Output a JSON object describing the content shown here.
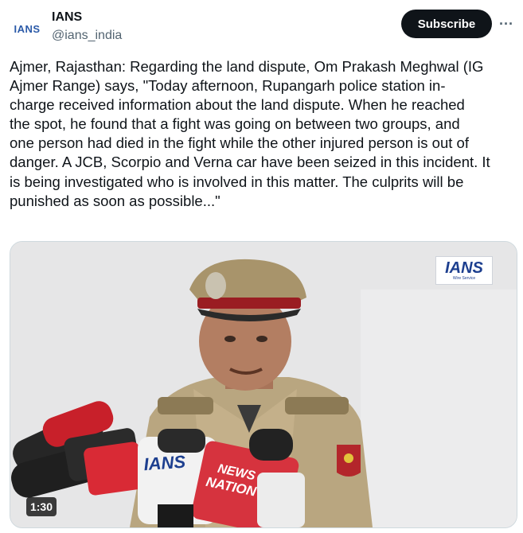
{
  "account": {
    "avatar_text": "IANS",
    "name": "IANS",
    "handle": "@ians_india"
  },
  "actions": {
    "subscribe_label": "Subscribe",
    "more_icon": "more-horizontal-icon",
    "more_glyph": "···"
  },
  "tweet": {
    "text": "Ajmer, Rajasthan: Regarding the land dispute, Om Prakash Meghwal (IG\nAjmer Range) says, \"Today afternoon, Rupangarh police station in-\ncharge received information about the land dispute. When he reached\nthe spot, he found that a fight was going on between two groups, and\none person had died in the fight while the other injured person is out of\ndanger. A JCB, Scorpio and Verna car have been seized in this incident. It\nis being investigated who is involved in this matter. The culprits will be\npunished as soon as possible...\""
  },
  "media": {
    "watermark_big": "IANS",
    "watermark_small": "Wire Service",
    "duration": "1:30",
    "mic_labels": {
      "ians": "IANS",
      "news_nation_1": "NEWS",
      "news_nation_2": "NATION"
    }
  },
  "colors": {
    "subscribe_bg": "#0f1419",
    "handle": "#536471",
    "ians_blue": "#1d3f8f"
  }
}
